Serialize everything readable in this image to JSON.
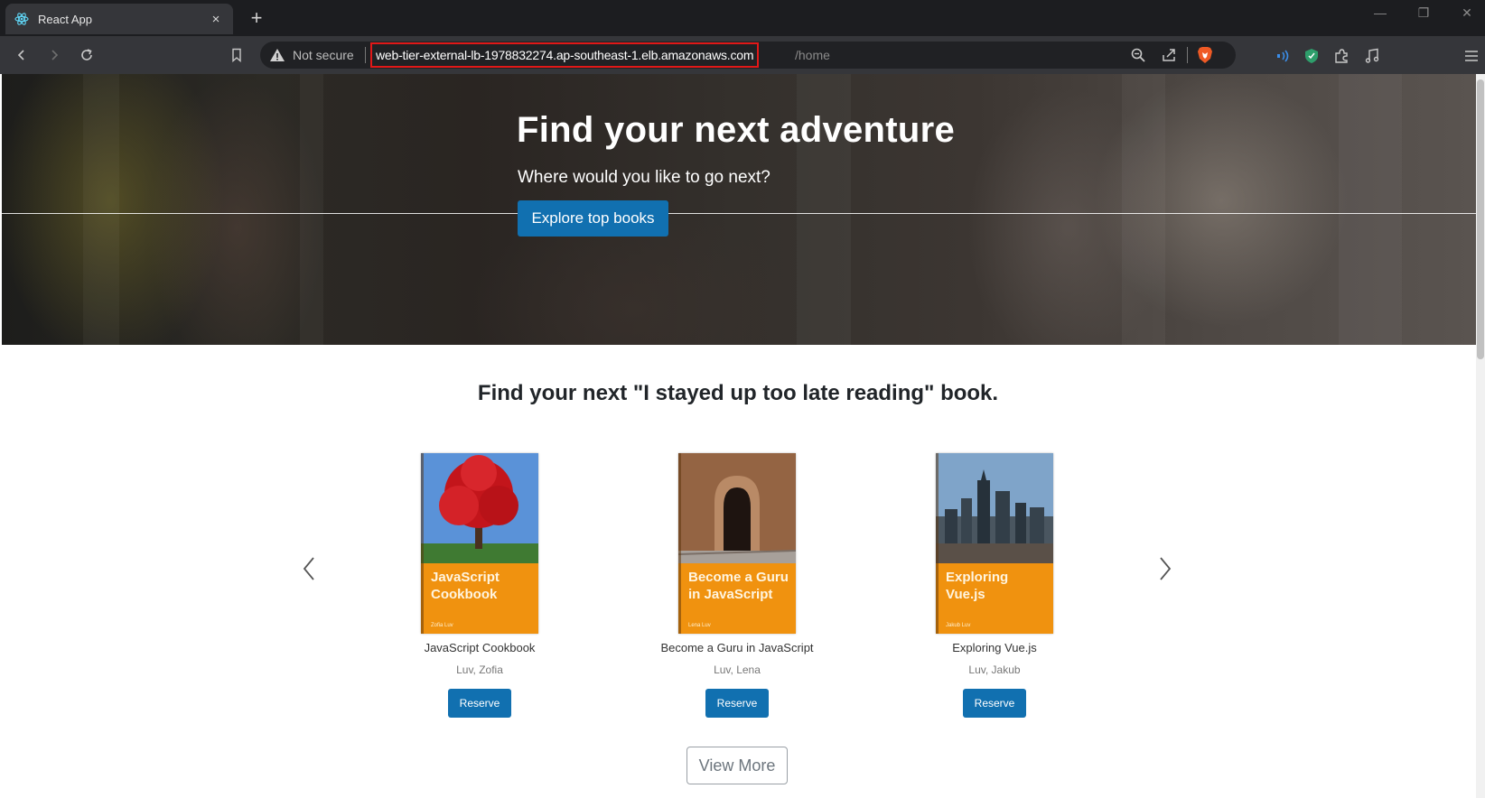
{
  "browser": {
    "tab": {
      "title": "React App",
      "close": "×"
    },
    "new_tab": "+",
    "window_controls": {
      "minimize": "—",
      "restore": "❐",
      "close": "✕"
    },
    "security_label": "Not secure",
    "url_host": "web-tier-external-lb-1978832274.ap-southeast-1.elb.amazonaws.com",
    "url_path": "/home",
    "icons": [
      "react-icon",
      "back-icon",
      "forward-icon",
      "reload-icon",
      "bookmark-icon",
      "warning-icon",
      "zoom-icon",
      "share-icon",
      "brave-shield-icon",
      "audio-icon",
      "extension-shield-icon",
      "puzzle-icon",
      "music-icon",
      "menu-icon"
    ],
    "colors": {
      "url_highlight": "#e01818",
      "chrome": "#35363a"
    }
  },
  "hero": {
    "title": "Find your next adventure",
    "subtitle": "Where would you like to go next?",
    "button": "Explore top books"
  },
  "section": {
    "title": "Find your next \"I stayed up too late reading\" book."
  },
  "carousel": {
    "prev": "‹",
    "next": "›",
    "books": [
      {
        "cover_title": "JavaScript Cookbook",
        "cover_author": "Zofia Luv",
        "title": "JavaScript Cookbook",
        "author": "Luv, Zofia",
        "button": "Reserve"
      },
      {
        "cover_title": "Become a Guru in JavaScript",
        "cover_author": "Lena Luv",
        "title": "Become a Guru in JavaScript",
        "author": "Luv, Lena",
        "button": "Reserve"
      },
      {
        "cover_title": "Exploring Vue.js",
        "cover_author": "Jakub Luv",
        "title": "Exploring Vue.js",
        "author": "Luv, Jakub",
        "button": "Reserve"
      }
    ]
  },
  "view_more": "View More",
  "colors": {
    "primary": "#1170b0",
    "cover_orange": "#f0920f"
  }
}
